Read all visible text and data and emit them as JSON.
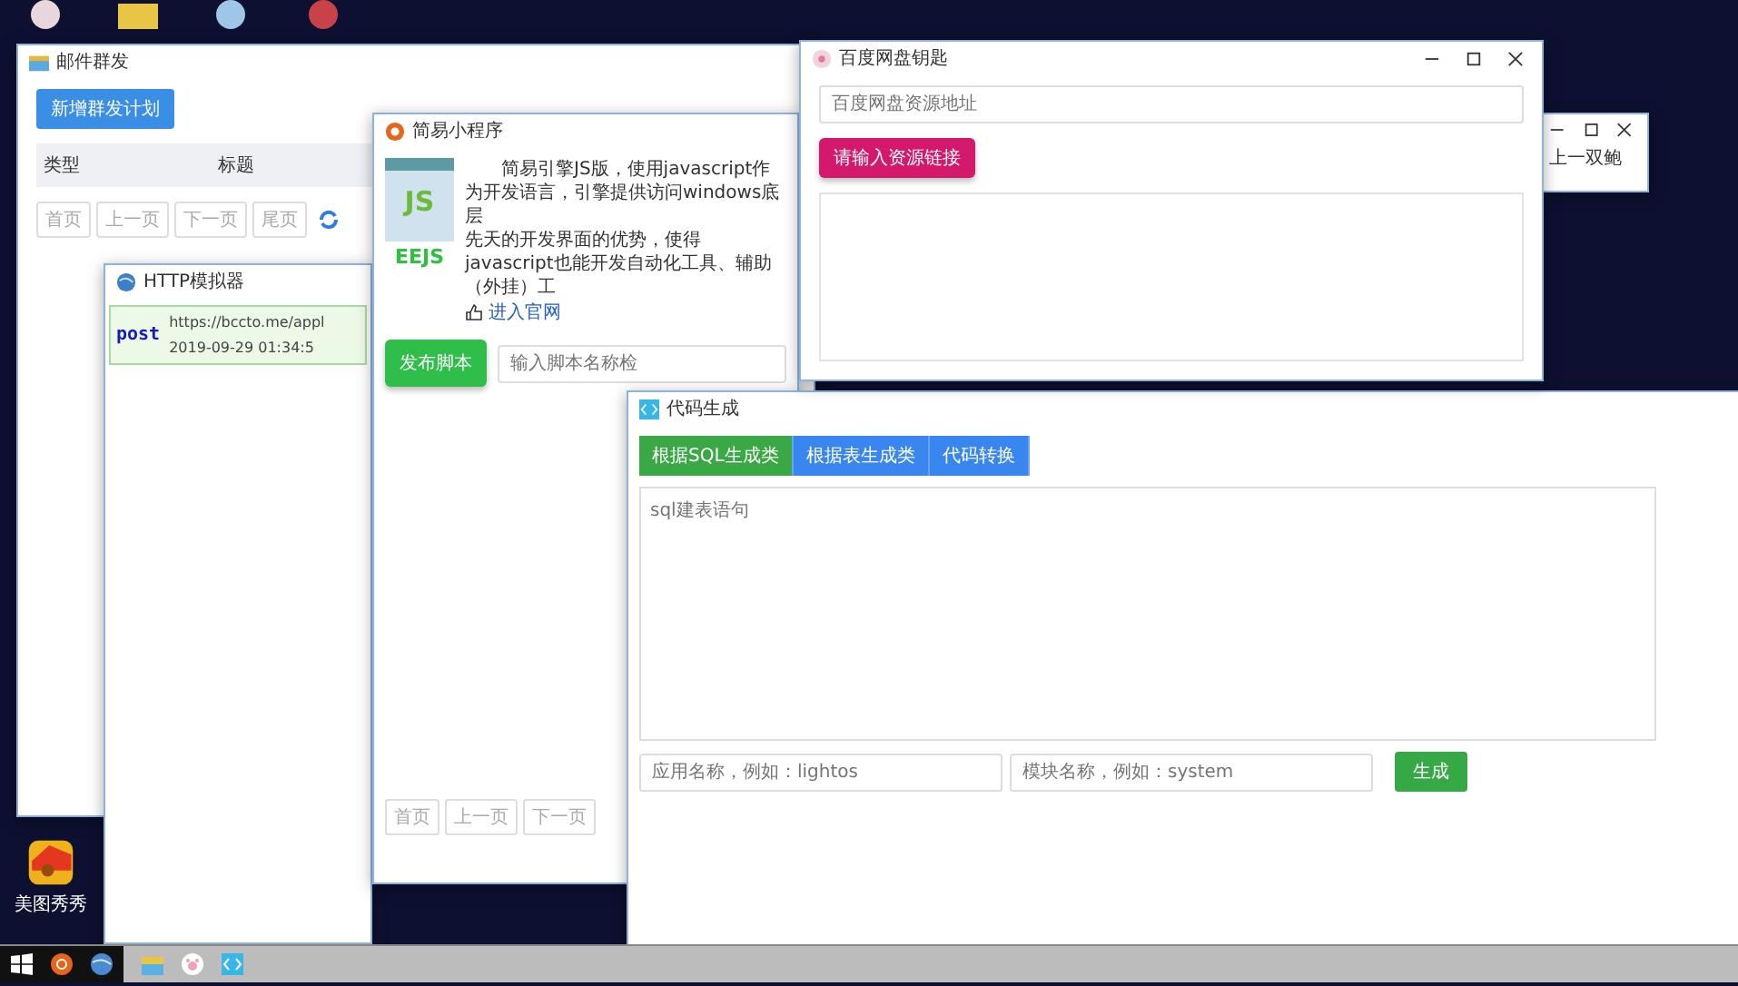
{
  "desktop_icons": [
    {
      "label": "美图秀秀"
    }
  ],
  "mail_window": {
    "title": "邮件群发",
    "add_button": "新增群发计划",
    "columns": [
      "类型",
      "标题"
    ],
    "pager": [
      "首页",
      "上一页",
      "下一页",
      "尾页"
    ]
  },
  "back_window": {
    "text": "上一双鲍"
  },
  "http_window": {
    "title": "HTTP模拟器",
    "requests": [
      {
        "method": "post",
        "url": "https://bccto.me/appl",
        "time": "2019-09-29 01:34:5"
      }
    ]
  },
  "script_window": {
    "title": "简易小程序",
    "logo_text": "JS",
    "logo_caption": "EEJS",
    "description": [
      "简易引擎JS版，使用javascript作为开发语言，引擎提供访问windows底层",
      "先天的开发界面的优势，使得javascript也能开发自动化工具、辅助（外挂）工"
    ],
    "link": "进入官网",
    "publish_button": "发布脚本",
    "name_placeholder": "输入脚本名称检",
    "pager": [
      "首页",
      "上一页",
      "下一页"
    ]
  },
  "code_window": {
    "title": "代码生成",
    "tabs": [
      {
        "label": "根据SQL生成类",
        "selected": true
      },
      {
        "label": "根据表生成类",
        "selected": false
      },
      {
        "label": "代码转换",
        "selected": false
      }
    ],
    "sql_placeholder": "sql建表语句",
    "app_placeholder": "应用名称，例如：lightos",
    "module_placeholder": "模块名称，例如：system",
    "generate_button": "生成"
  },
  "baidu_window": {
    "title": "百度网盘钥匙",
    "url_placeholder": "百度网盘资源地址",
    "submit_button": "请输入资源链接"
  }
}
